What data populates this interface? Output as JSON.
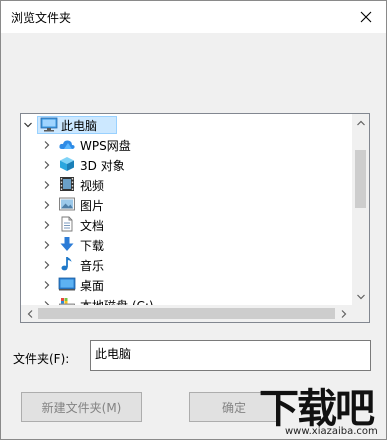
{
  "dialog": {
    "title": "浏览文件夹",
    "close_glyph": "✕"
  },
  "tree": {
    "items": [
      {
        "label": "此电脑",
        "icon": "computer-icon",
        "expander": "v"
      },
      {
        "label": "WPS网盘",
        "icon": "cloud-icon",
        "expander": ">"
      },
      {
        "label": "3D 对象",
        "icon": "3d-objects-icon",
        "expander": ">"
      },
      {
        "label": "视频",
        "icon": "video-icon",
        "expander": ">"
      },
      {
        "label": "图片",
        "icon": "pictures-icon",
        "expander": ">"
      },
      {
        "label": "文档",
        "icon": "documents-icon",
        "expander": ">"
      },
      {
        "label": "下载",
        "icon": "download-icon",
        "expander": ">"
      },
      {
        "label": "音乐",
        "icon": "music-icon",
        "expander": ">"
      },
      {
        "label": "桌面",
        "icon": "desktop-icon",
        "expander": ">"
      },
      {
        "label": "本地磁盘 (C:)",
        "icon": "drive-icon",
        "expander": ">"
      }
    ],
    "colors": {
      "selection": "#cce8ff",
      "selection_border": "#99d1ff"
    }
  },
  "folder": {
    "label": "文件夹(F):",
    "value": "此电脑"
  },
  "buttons": {
    "new_folder": "新建文件夹(M)",
    "ok": "确定"
  },
  "watermark": {
    "brand": "下载吧",
    "url": "www.xiazaiba.com"
  }
}
